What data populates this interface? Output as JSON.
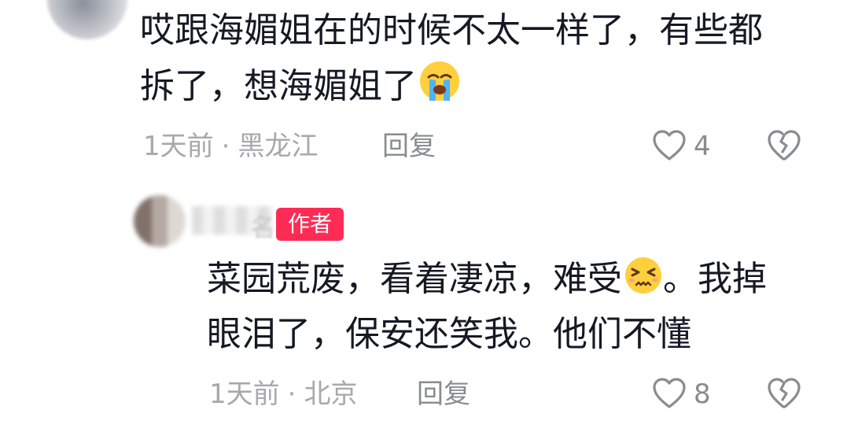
{
  "comments": [
    {
      "text_line1": "哎跟海媚姐在的时候不太一样了，有些都",
      "text_line2": "拆了，想海媚姐了",
      "emoji": "crying-face",
      "time": "1天前",
      "separator": "·",
      "location": "黑龙江",
      "reply_label": "回复",
      "like_count": "4"
    },
    {
      "name_tail": "名",
      "badge": "作者",
      "text_line1_a": "菜园荒废，看着凄凉，难受",
      "text_line1_b": "。我掉",
      "text_line2": "眼泪了，保安还笑我。他们不懂",
      "emoji": "persevering-face",
      "time": "1天前",
      "separator": "·",
      "location": "北京",
      "reply_label": "回复",
      "like_count": "8"
    }
  ],
  "colors": {
    "text": "#161823",
    "meta": "#a8a8ad",
    "badge_bg": "#fe2c55",
    "badge_text": "#ffffff"
  }
}
